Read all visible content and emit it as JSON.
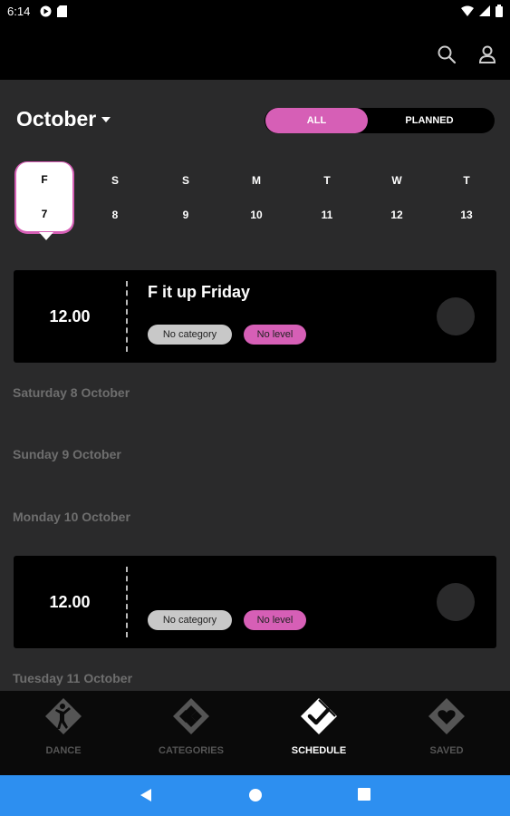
{
  "status_bar": {
    "time": "6:14"
  },
  "calendar": {
    "month": "October",
    "filters": {
      "all": "ALL",
      "planned": "PLANNED"
    },
    "days": [
      {
        "dow": "F",
        "num": "7",
        "selected": true
      },
      {
        "dow": "S",
        "num": "8"
      },
      {
        "dow": "S",
        "num": "9"
      },
      {
        "dow": "M",
        "num": "10"
      },
      {
        "dow": "T",
        "num": "11"
      },
      {
        "dow": "W",
        "num": "12"
      },
      {
        "dow": "T",
        "num": "13"
      }
    ]
  },
  "schedule": {
    "events": [
      {
        "time": "12.00",
        "title": "F it up Friday",
        "category": "No category",
        "level": "No level"
      },
      {
        "time": "12.00",
        "title": "",
        "category": "No category",
        "level": "No level"
      }
    ],
    "headings": [
      "Saturday 8 October",
      "Sunday 9 October",
      "Monday 10 October",
      "Tuesday 11 October"
    ]
  },
  "bottom_nav": {
    "items": [
      {
        "label": "DANCE",
        "icon": "dancer-icon"
      },
      {
        "label": "CATEGORIES",
        "icon": "categories-icon"
      },
      {
        "label": "SCHEDULE",
        "icon": "check-icon",
        "active": true
      },
      {
        "label": "SAVED",
        "icon": "heart-icon"
      }
    ]
  },
  "colors": {
    "accent": "#d65fb6",
    "background": "#2a2a2b",
    "system_nav": "#2d8ff0"
  }
}
